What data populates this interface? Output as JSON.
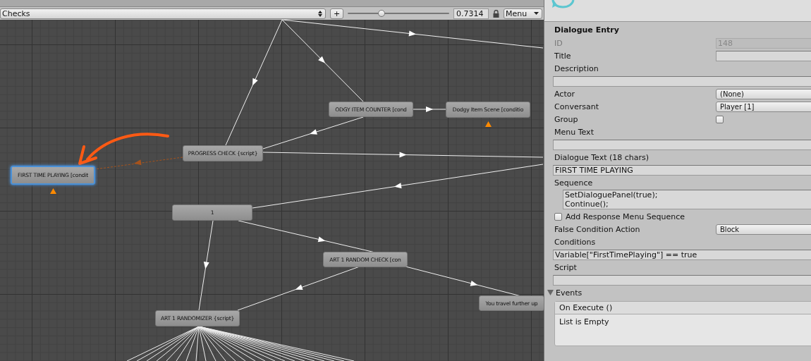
{
  "toolbar": {
    "conversation": "Checks",
    "add_button": "+",
    "zoom": {
      "level": 0.33
    },
    "zoom_value": "0.7314",
    "menu": "Menu"
  },
  "canvas": {
    "nodes": [
      {
        "label": "ODGY ITEM COUNTER [cond",
        "selected": false,
        "warning": false
      },
      {
        "label": "Dodgy Item Scene [conditio",
        "selected": false,
        "warning": true
      },
      {
        "label": "PROGRESS CHECK {script}",
        "selected": false,
        "warning": false
      },
      {
        "label": "FIRST TIME PLAYING [condit",
        "selected": true,
        "warning": true
      },
      {
        "label": "1",
        "selected": false,
        "warning": false
      },
      {
        "label": "ART 1 RANDOM CHECK [con",
        "selected": false,
        "warning": false
      },
      {
        "label": "ART 1 RANDOMIZER {script}",
        "selected": false,
        "warning": false
      },
      {
        "label": "You travel further up",
        "selected": false,
        "warning": false
      }
    ]
  },
  "inspector": {
    "heading": "Dialogue Entry",
    "rows": [
      {
        "kind": "field",
        "label": "ID",
        "value": "148",
        "disabled": true
      },
      {
        "kind": "field",
        "label": "Title",
        "disabled": false
      },
      {
        "kind": "label",
        "label": "Description"
      },
      {
        "kind": "wide",
        "value": ""
      },
      {
        "kind": "dropdown",
        "label": "Actor",
        "value": "(None)"
      },
      {
        "kind": "dropdown",
        "label": "Conversant",
        "value": "Player [1]"
      },
      {
        "kind": "checkbox",
        "label": "Group",
        "checked": false
      },
      {
        "kind": "label",
        "label": "Menu Text"
      },
      {
        "kind": "wide",
        "value": ""
      },
      {
        "kind": "label",
        "label": "Dialogue Text (18 chars)"
      },
      {
        "kind": "wide",
        "value": "FIRST TIME PLAYING"
      },
      {
        "kind": "label",
        "label": "Sequence"
      },
      {
        "kind": "multiline",
        "lines": [
          "SetDialoguePanel(true);",
          "Continue();"
        ]
      },
      {
        "kind": "toggle",
        "label": "Add Response Menu Sequence",
        "checked": false
      },
      {
        "kind": "dropdown",
        "label": "False Condition Action",
        "value": "Block"
      },
      {
        "kind": "label",
        "label": "Conditions"
      },
      {
        "kind": "wide",
        "value": "Variable[\"FirstTimePlaying\"] == true"
      },
      {
        "kind": "label",
        "label": "Script"
      },
      {
        "kind": "wide",
        "value": ""
      }
    ],
    "events": {
      "label": "Events",
      "expanded": true,
      "header": "On Execute ()",
      "empty": "List is Empty"
    }
  }
}
